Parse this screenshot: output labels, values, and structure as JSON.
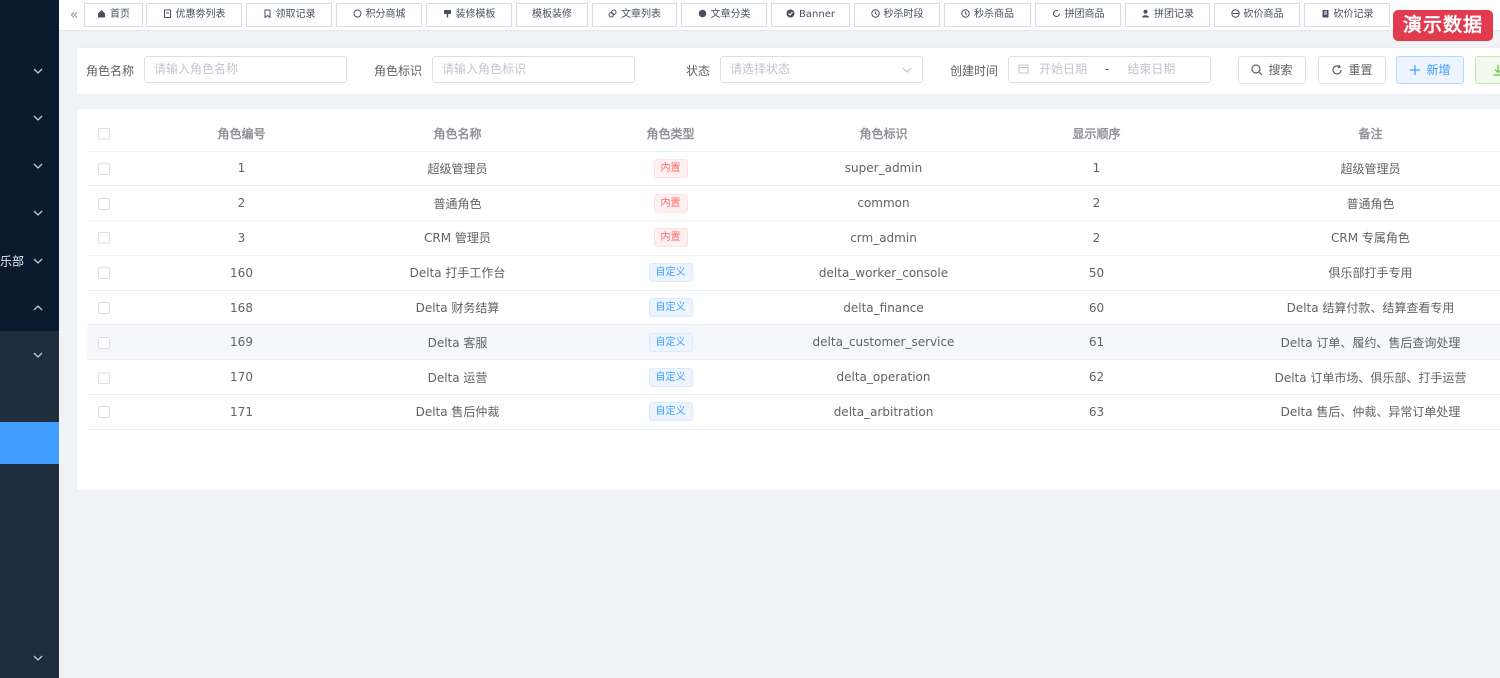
{
  "sidebar": {
    "items": [
      {
        "label": "",
        "expanded": false
      },
      {
        "label": "",
        "expanded": false
      },
      {
        "label": "",
        "expanded": false
      },
      {
        "label": "",
        "expanded": false
      },
      {
        "label": "乐部",
        "expanded": false
      },
      {
        "label": "",
        "expanded": true
      },
      {
        "label": "",
        "expanded": false
      },
      {
        "label": "",
        "expanded": false
      }
    ]
  },
  "tabs": [
    {
      "label": "首页",
      "icon": "home-icon"
    },
    {
      "label": "优惠劵列表",
      "icon": "coupon-icon"
    },
    {
      "label": "领取记录",
      "icon": "bookmark-icon"
    },
    {
      "label": "积分商城",
      "icon": "points-icon"
    },
    {
      "label": "装修模板",
      "icon": "paint-icon"
    },
    {
      "label": "模板装修",
      "icon": ""
    },
    {
      "label": "文章列表",
      "icon": "link-icon"
    },
    {
      "label": "文章分类",
      "icon": "gear-icon"
    },
    {
      "label": "Banner",
      "icon": "banner-icon"
    },
    {
      "label": "秒杀时段",
      "icon": "clock-icon"
    },
    {
      "label": "秒杀商品",
      "icon": "clock-icon"
    },
    {
      "label": "拼团商品",
      "icon": "loop-icon"
    },
    {
      "label": "拼团记录",
      "icon": "user-icon"
    },
    {
      "label": "砍价商品",
      "icon": "cart-icon"
    },
    {
      "label": "砍价记录",
      "icon": "list-icon"
    }
  ],
  "demo_badge": "演示数据",
  "search": {
    "role_name_label": "角色名称",
    "role_name_placeholder": "请输入角色名称",
    "role_key_label": "角色标识",
    "role_key_placeholder": "请输入角色标识",
    "status_label": "状态",
    "status_placeholder": "请选择状态",
    "created_label": "创建时间",
    "start_date_placeholder": "开始日期",
    "date_separator": "-",
    "end_date_placeholder": "结束日期",
    "search_button": "搜索",
    "reset_button": "重置",
    "add_button": "新增"
  },
  "table": {
    "columns": [
      "角色编号",
      "角色名称",
      "角色类型",
      "角色标识",
      "显示顺序",
      "备注"
    ],
    "rows": [
      {
        "id": "1",
        "name": "超级管理员",
        "type": "内置",
        "type_style": "danger",
        "key": "super_admin",
        "sort": "1",
        "remark": "超级管理员"
      },
      {
        "id": "2",
        "name": "普通角色",
        "type": "内置",
        "type_style": "danger",
        "key": "common",
        "sort": "2",
        "remark": "普通角色"
      },
      {
        "id": "3",
        "name": "CRM 管理员",
        "type": "内置",
        "type_style": "danger",
        "key": "crm_admin",
        "sort": "2",
        "remark": "CRM 专属角色"
      },
      {
        "id": "160",
        "name": "Delta 打手工作台",
        "type": "自定义",
        "type_style": "info",
        "key": "delta_worker_console",
        "sort": "50",
        "remark": "俱乐部打手专用"
      },
      {
        "id": "168",
        "name": "Delta 财务结算",
        "type": "自定义",
        "type_style": "info",
        "key": "delta_finance",
        "sort": "60",
        "remark": "Delta 结算付款、结算查看专用"
      },
      {
        "id": "169",
        "name": "Delta 客服",
        "type": "自定义",
        "type_style": "info",
        "key": "delta_customer_service",
        "sort": "61",
        "remark": "Delta 订单、履约、售后查询处理"
      },
      {
        "id": "170",
        "name": "Delta 运营",
        "type": "自定义",
        "type_style": "info",
        "key": "delta_operation",
        "sort": "62",
        "remark": "Delta 订单市场、俱乐部、打手运营"
      },
      {
        "id": "171",
        "name": "Delta 售后仲裁",
        "type": "自定义",
        "type_style": "info",
        "key": "delta_arbitration",
        "sort": "63",
        "remark": "Delta 售后、仲裁、异常订单处理"
      }
    ]
  }
}
